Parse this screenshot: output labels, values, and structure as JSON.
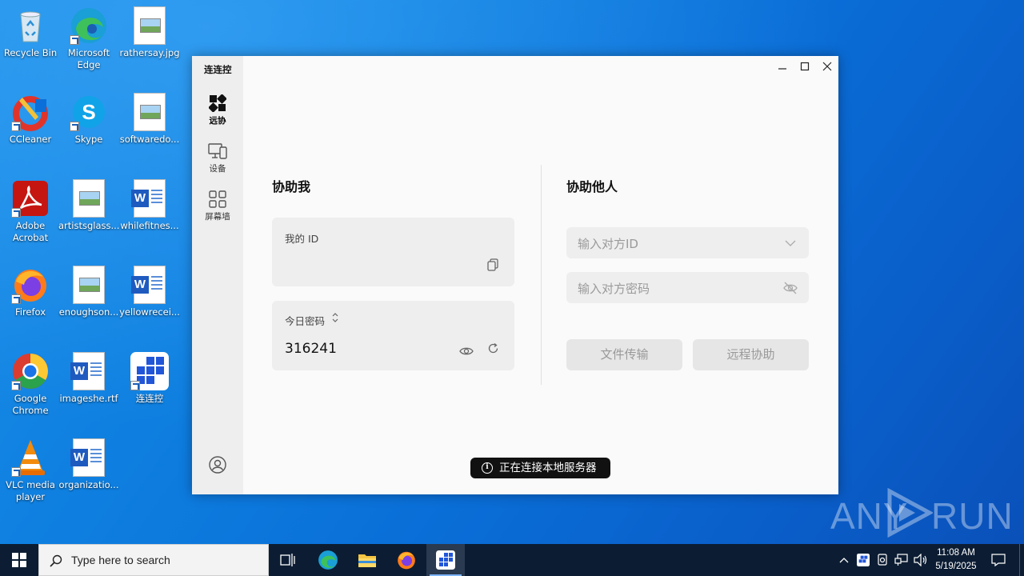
{
  "desktop": {
    "icons": [
      {
        "label": "Recycle Bin",
        "icon": "recycle-bin-icon"
      },
      {
        "label": "Microsoft Edge",
        "icon": "edge-icon"
      },
      {
        "label": "rathersay.jpg",
        "icon": "image-file-icon"
      },
      {
        "label": "CCleaner",
        "icon": "ccleaner-icon"
      },
      {
        "label": "Skype",
        "icon": "skype-icon"
      },
      {
        "label": "softwaredo...",
        "icon": "image-file-icon"
      },
      {
        "label": "Adobe Acrobat",
        "icon": "acrobat-icon"
      },
      {
        "label": "artistsglass...",
        "icon": "image-file-icon"
      },
      {
        "label": "whilefitnes...",
        "icon": "word-file-icon"
      },
      {
        "label": "Firefox",
        "icon": "firefox-icon"
      },
      {
        "label": "enoughson...",
        "icon": "image-file-icon"
      },
      {
        "label": "yellowrecei...",
        "icon": "word-file-icon"
      },
      {
        "label": "Google Chrome",
        "icon": "chrome-icon"
      },
      {
        "label": "imageshe.rtf",
        "icon": "word-file-icon"
      },
      {
        "label": "连连控",
        "icon": "lianliankong-icon"
      },
      {
        "label": "VLC media player",
        "icon": "vlc-icon"
      },
      {
        "label": "organizatio...",
        "icon": "word-file-icon"
      }
    ]
  },
  "window": {
    "app_title": "连连控",
    "nav": [
      {
        "label": "远协",
        "icon": "remote-assist-icon",
        "active": true
      },
      {
        "label": "设备",
        "icon": "devices-icon",
        "active": false
      },
      {
        "label": "屏幕墙",
        "icon": "screen-wall-icon",
        "active": false
      }
    ],
    "controls": {
      "minimize": "—",
      "maximize": "☐",
      "close": "✕"
    },
    "help_me": {
      "title": "协助我",
      "my_id_label": "我的 ID",
      "my_id_value": "",
      "password_label": "今日密码",
      "password_value": "316241"
    },
    "help_others": {
      "title": "协助他人",
      "peer_id_placeholder": "输入对方ID",
      "peer_password_placeholder": "输入对方密码",
      "file_transfer_label": "文件传输",
      "remote_assist_label": "远程协助"
    },
    "toast": "正在连接本地服务器"
  },
  "taskbar": {
    "search_placeholder": "Type here to search",
    "time": "11:08 AM",
    "date": "5/19/2025"
  },
  "watermark": {
    "left": "ANY",
    "right": "RUN"
  }
}
